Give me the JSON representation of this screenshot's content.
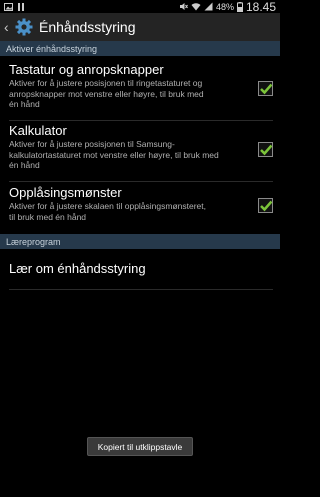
{
  "status_bar": {
    "battery_percent": "48%",
    "time": "18.45",
    "icons": [
      "gallery-icon",
      "pause-icon",
      "mute-icon",
      "wifi-icon",
      "signal-icon",
      "battery-icon"
    ]
  },
  "action_bar": {
    "title": "Énhåndsstyring",
    "icon": "gear-icon"
  },
  "sections": {
    "activate_header": "Aktiver énhåndsstyring",
    "learn_header": "Læreprogram"
  },
  "items": [
    {
      "title": "Tastatur og anropsknapper",
      "desc_lines": [
        "Aktiver for å justere posisjonen til ringetastaturet og",
        "anropsknapper mot venstre eller høyre, til bruk med",
        "én hånd"
      ],
      "checked": true
    },
    {
      "title": "Kalkulator",
      "desc_lines": [
        "Aktiver for å justere posisjonen til Samsung-",
        "kalkulatortastaturet mot venstre eller høyre, til bruk med",
        "én hånd"
      ],
      "checked": true
    },
    {
      "title": "Opplåsingsmønster",
      "desc_lines": [
        "Aktiver for å justere skalaen til opplåsingsmønsteret,",
        "til bruk med én hånd"
      ],
      "checked": true
    }
  ],
  "learn_item": {
    "title": "Lær om énhåndsstyring"
  },
  "toast": {
    "text": "Kopiert til utklippstavle"
  },
  "colors": {
    "section_header_bg": "#26394b",
    "check_green": "#7cc43a"
  }
}
